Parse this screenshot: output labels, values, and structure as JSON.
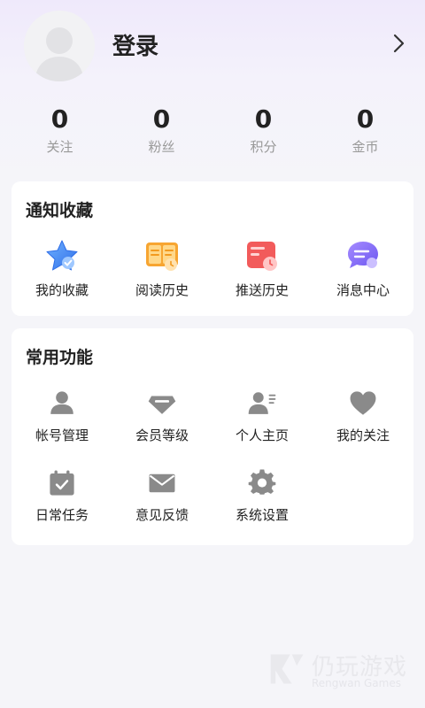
{
  "profile": {
    "login_label": "登录"
  },
  "stats": [
    {
      "value": "0",
      "label": "关注"
    },
    {
      "value": "0",
      "label": "粉丝"
    },
    {
      "value": "0",
      "label": "积分"
    },
    {
      "value": "0",
      "label": "金币"
    }
  ],
  "notify_section": {
    "title": "通知收藏",
    "items": [
      {
        "label": "我的收藏",
        "icon": "star-icon"
      },
      {
        "label": "阅读历史",
        "icon": "book-icon"
      },
      {
        "label": "推送历史",
        "icon": "push-history-icon"
      },
      {
        "label": "消息中心",
        "icon": "message-bubble-icon"
      }
    ]
  },
  "functions_section": {
    "title": "常用功能",
    "items": [
      {
        "label": "帐号管理",
        "icon": "user-icon"
      },
      {
        "label": "会员等级",
        "icon": "gem-icon"
      },
      {
        "label": "个人主页",
        "icon": "profile-card-icon"
      },
      {
        "label": "我的关注",
        "icon": "heart-icon"
      },
      {
        "label": "日常任务",
        "icon": "calendar-check-icon"
      },
      {
        "label": "意见反馈",
        "icon": "mail-icon"
      },
      {
        "label": "系统设置",
        "icon": "gear-icon"
      }
    ]
  },
  "watermark": {
    "cn": "仍玩游戏",
    "en": "Rengwan Games"
  },
  "colors": {
    "accent_blue": "#4a8df7",
    "accent_orange": "#f5a623",
    "accent_red": "#f04848",
    "accent_purple": "#7b6cf6",
    "icon_gray": "#8a8a8a"
  }
}
